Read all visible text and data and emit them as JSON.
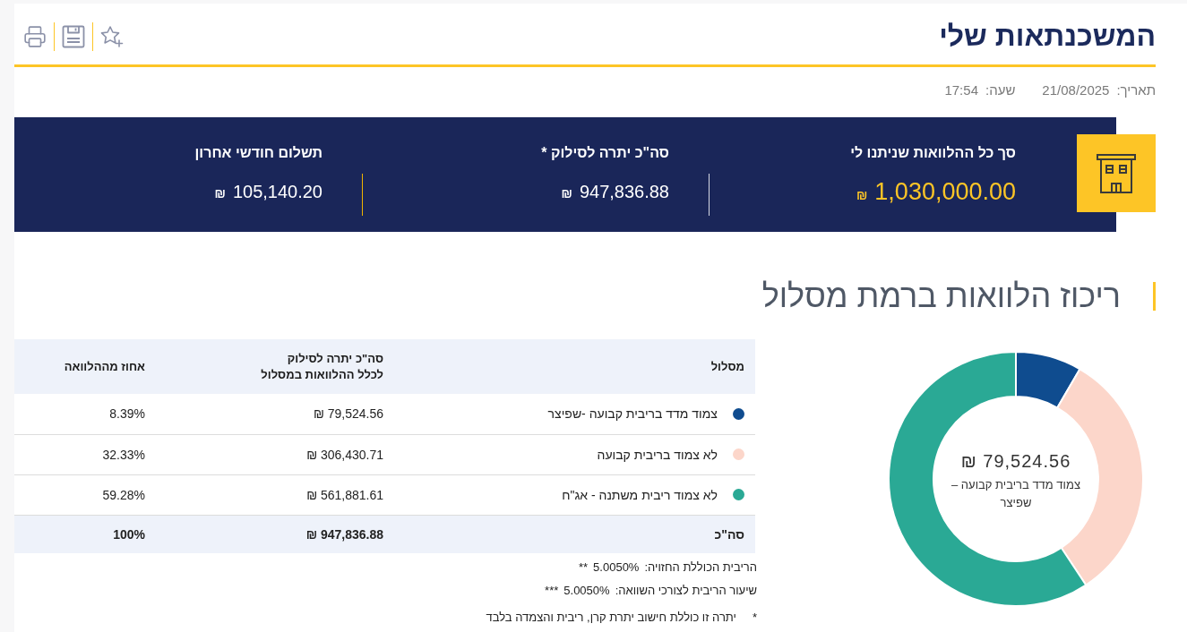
{
  "header": {
    "title": "המשכנתאות שלי",
    "actions": [
      {
        "kind": "favorite"
      },
      {
        "kind": "save"
      },
      {
        "kind": "print"
      }
    ]
  },
  "meta": {
    "date_label": "תאריך:",
    "date": "21/08/2025",
    "time_label": "שעה:",
    "time": "17:54"
  },
  "summary": {
    "stats": [
      {
        "label": "סך כל ההלוואות שניתנו לי",
        "value": "1,030,000.00",
        "currency": "₪",
        "highlighted": true
      },
      {
        "label": "סה\"כ יתרה לסילוק *",
        "value": "947,836.88",
        "currency": "₪",
        "highlighted": false
      },
      {
        "label": "תשלום חודשי אחרון",
        "value": "105,140.20",
        "currency": "₪",
        "highlighted": false
      }
    ]
  },
  "section": {
    "title": "ריכוז הלוואות ברמת מסלול"
  },
  "table": {
    "columns": [
      "מסלול",
      "סה\"כ יתרה לסילוק\nלכלל ההלוואות במסלול",
      "אחוז מההלוואה"
    ],
    "rows": [
      {
        "name": "צמוד מדד בריבית קבועה -שפיצר",
        "color": "#0f4c8f",
        "balance": "79,524.56 ₪",
        "share": "8.39%"
      },
      {
        "name": "לא צמוד בריבית קבועה",
        "color": "#fcd6ca",
        "balance": "306,430.71 ₪",
        "share": "32.33%"
      },
      {
        "name": "לא צמוד ריבית משתנה - אג\"ח",
        "color": "#2aa995",
        "balance": "561,881.61 ₪",
        "share": "59.28%"
      }
    ],
    "total": {
      "label": "סה\"כ",
      "balance": "947,836.88 ₪",
      "share": "100%"
    }
  },
  "notes": [
    {
      "label": "הריבית הכוללת החזויה:",
      "value": "5.0050%",
      "mark": "**"
    },
    {
      "label": "שיעור הריבית לצורכי השוואה:",
      "value": "5.0050%",
      "mark": "***"
    }
  ],
  "footnote": {
    "mark": "*",
    "text": "יתרה זו כוללת חישוב יתרת קרן, ריבית והצמדה בלבד"
  },
  "chart": {
    "chart_data": {
      "type": "donut",
      "values": [
        8.39,
        32.33,
        59.28
      ]
    },
    "center_value": "79,524.56 ₪",
    "center_label": "צמוד מדד בריבית קבועה – שפיצר"
  }
}
